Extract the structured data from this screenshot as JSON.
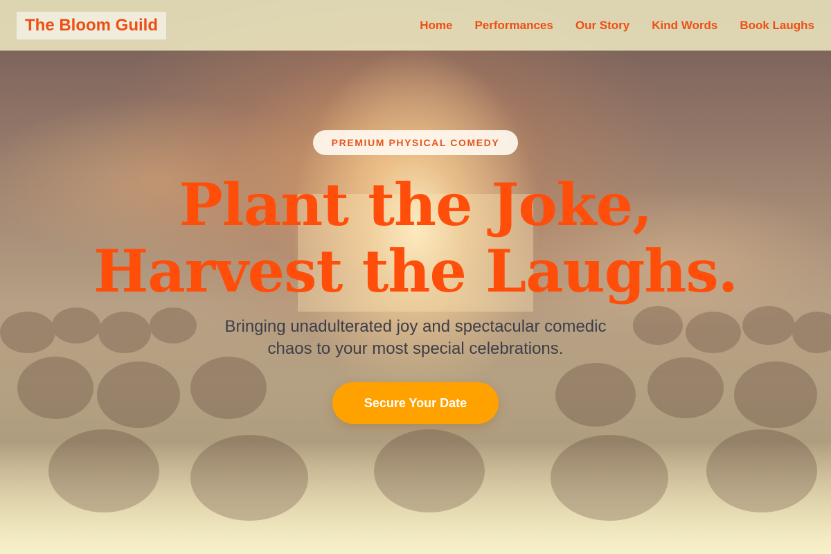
{
  "header": {
    "logo": "The Bloom Guild",
    "nav": [
      "Home",
      "Performances",
      "Our Story",
      "Kind Words",
      "Book Laughs"
    ]
  },
  "hero": {
    "badge": "PREMIUM PHYSICAL COMEDY",
    "headline_line1": "Plant the Joke,",
    "headline_line2": "Harvest the Laughs.",
    "subtitle_line1": "Bringing unadulterated joy and spectacular comedic",
    "subtitle_line2": "chaos to your most special celebrations.",
    "cta": "Secure Your Date"
  },
  "colors": {
    "accent": "#ff4d0a",
    "cta": "#ffa200",
    "header_bg": "#ece6be"
  }
}
